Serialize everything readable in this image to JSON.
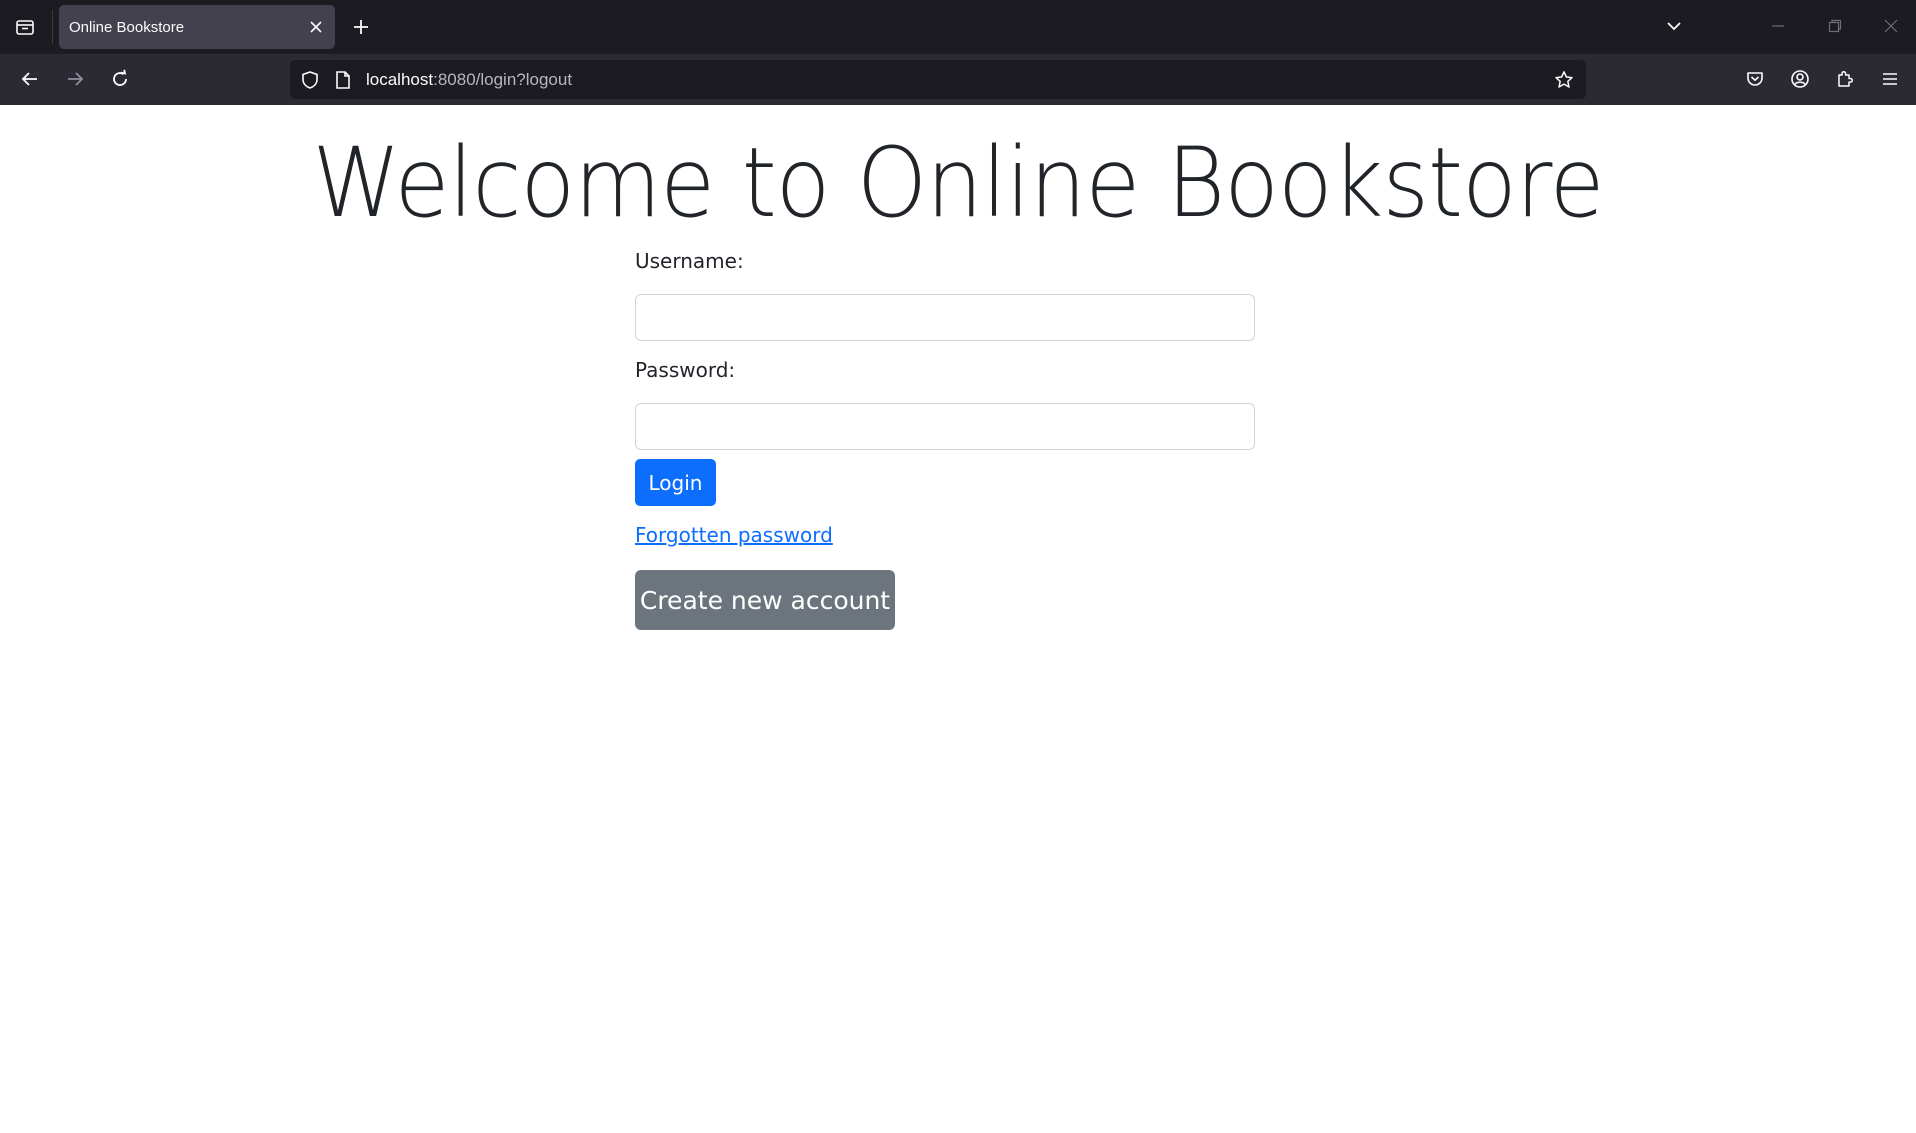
{
  "browser": {
    "tab": {
      "title": "Online Bookstore"
    },
    "url": {
      "host": "localhost",
      "rest": ":8080/login?logout"
    },
    "colors": {
      "tabbar": "#1c1b22",
      "toolbar": "#2b2a33",
      "active_tab": "#42414d"
    }
  },
  "page": {
    "title": "Welcome to Online Bookstore",
    "form": {
      "username_label": "Username:",
      "username_value": "",
      "password_label": "Password:",
      "password_value": "",
      "login_label": "Login",
      "forgot_label": "Forgotten password",
      "create_label": "Create new account"
    },
    "colors": {
      "primary": "#0d6efd",
      "secondary": "#6c757d",
      "text": "#212529"
    }
  }
}
